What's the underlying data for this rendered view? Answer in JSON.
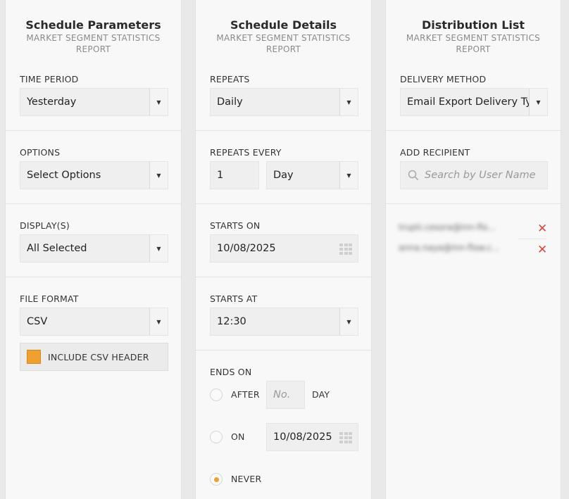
{
  "schedule_parameters": {
    "title": "Schedule Parameters",
    "subtitle_line1": "MARKET SEGMENT STATISTICS",
    "subtitle_line2": "REPORT",
    "time_period": {
      "label": "TIME PERIOD",
      "value": "Yesterday"
    },
    "options": {
      "label": "OPTIONS",
      "value": "Select Options"
    },
    "displays": {
      "label": "DISPLAY(S)",
      "value": "All Selected"
    },
    "file_format": {
      "label": "FILE FORMAT",
      "value": "CSV"
    },
    "include_header": {
      "label": "INCLUDE CSV HEADER",
      "checked": true
    }
  },
  "schedule_details": {
    "title": "Schedule Details",
    "subtitle_line1": "MARKET SEGMENT STATISTICS",
    "subtitle_line2": "REPORT",
    "repeats": {
      "label": "REPEATS",
      "value": "Daily"
    },
    "repeats_every": {
      "label": "REPEATS EVERY",
      "count": "1",
      "unit": "Day"
    },
    "starts_on": {
      "label": "STARTS ON",
      "value": "10/08/2025"
    },
    "starts_at": {
      "label": "STARTS AT",
      "value": "12:30"
    },
    "ends_on": {
      "label": "ENDS ON",
      "after_label": "AFTER",
      "after_placeholder": "No.",
      "after_unit": "DAY",
      "on_label": "ON",
      "on_value": "10/08/2025",
      "never_label": "NEVER",
      "selected": "never"
    }
  },
  "distribution_list": {
    "title": "Distribution List",
    "subtitle_line1": "MARKET SEGMENT STATISTICS",
    "subtitle_line2": "REPORT",
    "delivery_method": {
      "label": "DELIVERY METHOD",
      "value": "Email Export Delivery Type"
    },
    "add_recipient": {
      "label": "ADD RECIPIENT",
      "placeholder": "Search by User Name"
    },
    "recipients": [
      "trupti.cesora@inn-flo...",
      "anna.naya@inn-flow.c..."
    ]
  },
  "colors": {
    "accent": "#f0a030",
    "remove": "#d9473f"
  },
  "icons": {
    "dropdown": "caret-down-icon",
    "calendar": "calendar-grid-icon",
    "search": "search-icon",
    "remove": "close-icon"
  }
}
